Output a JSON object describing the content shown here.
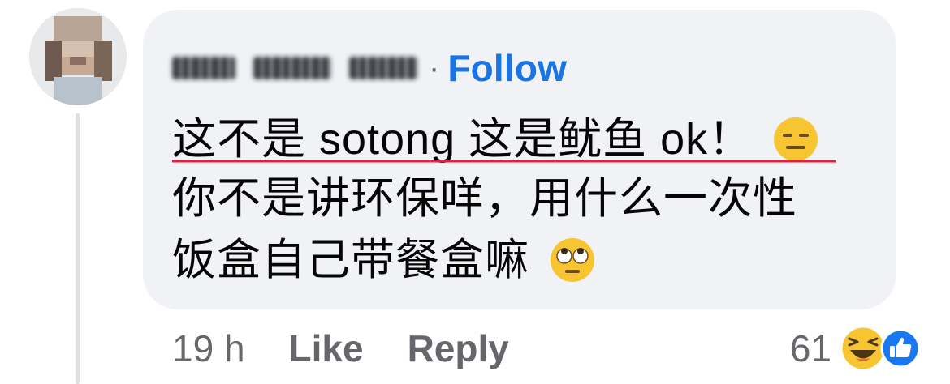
{
  "comment": {
    "follow_label": "Follow",
    "separator": "·",
    "lines": [
      "这不是 sotong 这是鱿鱼 ok！",
      "你不是讲环保咩，用什么一次性",
      "饭盒自己带餐盒嘛"
    ],
    "line1_emoji": "expressionless-face-icon",
    "line3_emoji": "eye-roll-face-icon"
  },
  "footer": {
    "time": "19 h",
    "like_label": "Like",
    "reply_label": "Reply",
    "reaction_count": "61",
    "reaction_icons": [
      "laughing-face-icon",
      "thumbs-up-icon"
    ]
  },
  "colors": {
    "bubble_bg": "#f0f2f5",
    "follow_blue": "#1b74e4",
    "meta_gray": "#65676b",
    "text": "#050505",
    "spellcheck_red": "#e41e3f",
    "like_blue": "#1877f2",
    "emoji_yellow": "#f7c531"
  }
}
